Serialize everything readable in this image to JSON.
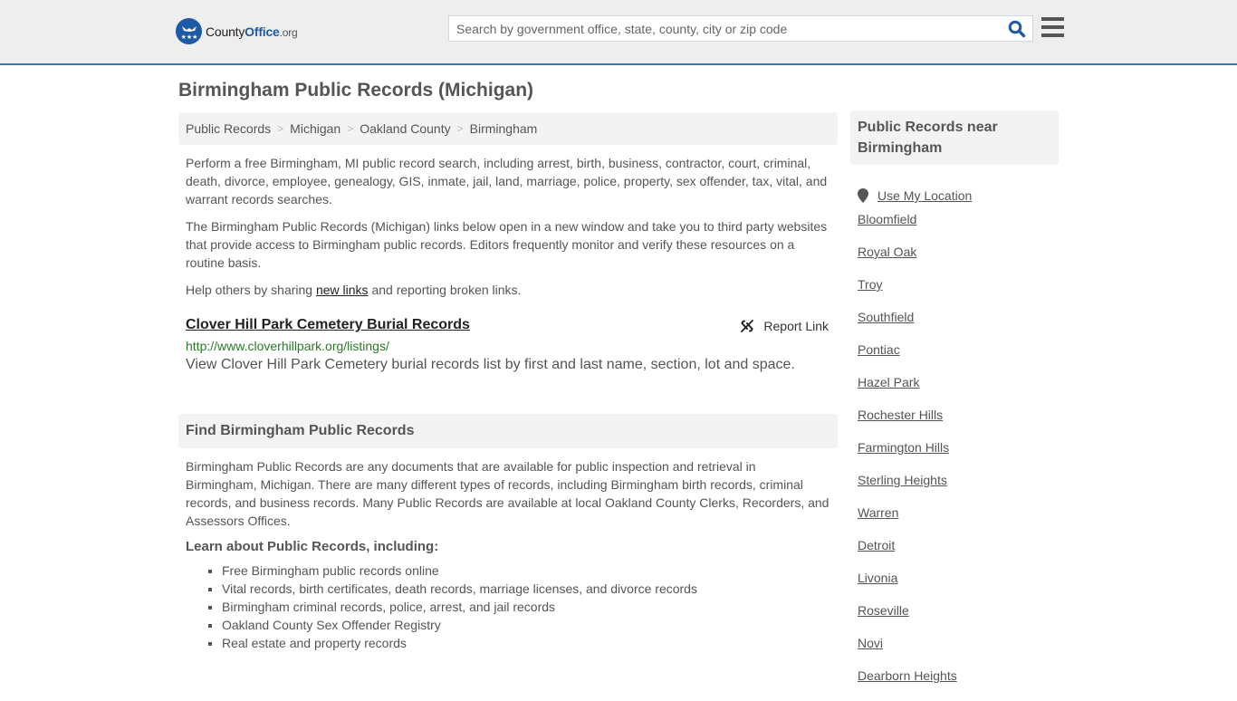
{
  "header": {
    "logo": {
      "county": "County",
      "office": "Office",
      "org": ".org"
    },
    "search": {
      "placeholder": "Search by government office, state, county, city or zip code",
      "value": ""
    },
    "icons": {
      "search": "search-icon",
      "menu": "hamburger-menu-icon",
      "logo": "eagle-stars-badge-icon"
    }
  },
  "page": {
    "title": "Birmingham Public Records (Michigan)"
  },
  "breadcrumb": [
    {
      "label": "Public Records"
    },
    {
      "label": "Michigan"
    },
    {
      "label": "Oakland County"
    },
    {
      "label": "Birmingham"
    }
  ],
  "breadcrumb_separator": ">",
  "intro": {
    "p1": "Perform a free Birmingham, MI public record search, including arrest, birth, business, contractor, court, criminal, death, divorce, employee, genealogy, GIS, inmate, jail, land, marriage, police, property, sex offender, tax, vital, and warrant records searches.",
    "p2": "The Birmingham Public Records (Michigan) links below open in a new window and take you to third party websites that provide access to Birmingham public records. Editors frequently monitor and verify these resources on a routine basis.",
    "p3_before": "Help others by sharing ",
    "p3_link": "new links",
    "p3_after": " and reporting broken links."
  },
  "results": [
    {
      "title": "Clover Hill Park Cemetery Burial Records",
      "url": "http://www.cloverhillpark.org/listings/",
      "description": "View Clover Hill Park Cemetery burial records list by first and last name, section, lot and space.",
      "report_label": "Report Link",
      "report_icon": "broken-link-icon"
    }
  ],
  "find_section": {
    "heading": "Find Birmingham Public Records",
    "paragraph": "Birmingham Public Records are any documents that are available for public inspection and retrieval in Birmingham, Michigan. There are many different types of records, including Birmingham birth records, criminal records, and business records. Many Public Records are available at local Oakland County Clerks, Recorders, and Assessors Offices.",
    "learn_heading": "Learn about Public Records, including:",
    "items": [
      "Free Birmingham public records online",
      "Vital records, birth certificates, death records, marriage licenses, and divorce records",
      "Birmingham criminal records, police, arrest, and jail records",
      "Oakland County Sex Offender Registry",
      "Real estate and property records"
    ]
  },
  "sidebar": {
    "heading": "Public Records near Birmingham",
    "use_location": "Use My Location",
    "location_icon": "map-pin-icon",
    "cities": [
      "Bloomfield",
      "Royal Oak",
      "Troy",
      "Southfield",
      "Pontiac",
      "Hazel Park",
      "Rochester Hills",
      "Farmington Hills",
      "Sterling Heights",
      "Warren",
      "Detroit",
      "Livonia",
      "Roseville",
      "Novi",
      "Dearborn Heights"
    ]
  },
  "colors": {
    "brand_blue": "#1f5aa6",
    "header_border": "#2d7ab5",
    "url_green": "#2b7a2b",
    "text": "#555555"
  }
}
